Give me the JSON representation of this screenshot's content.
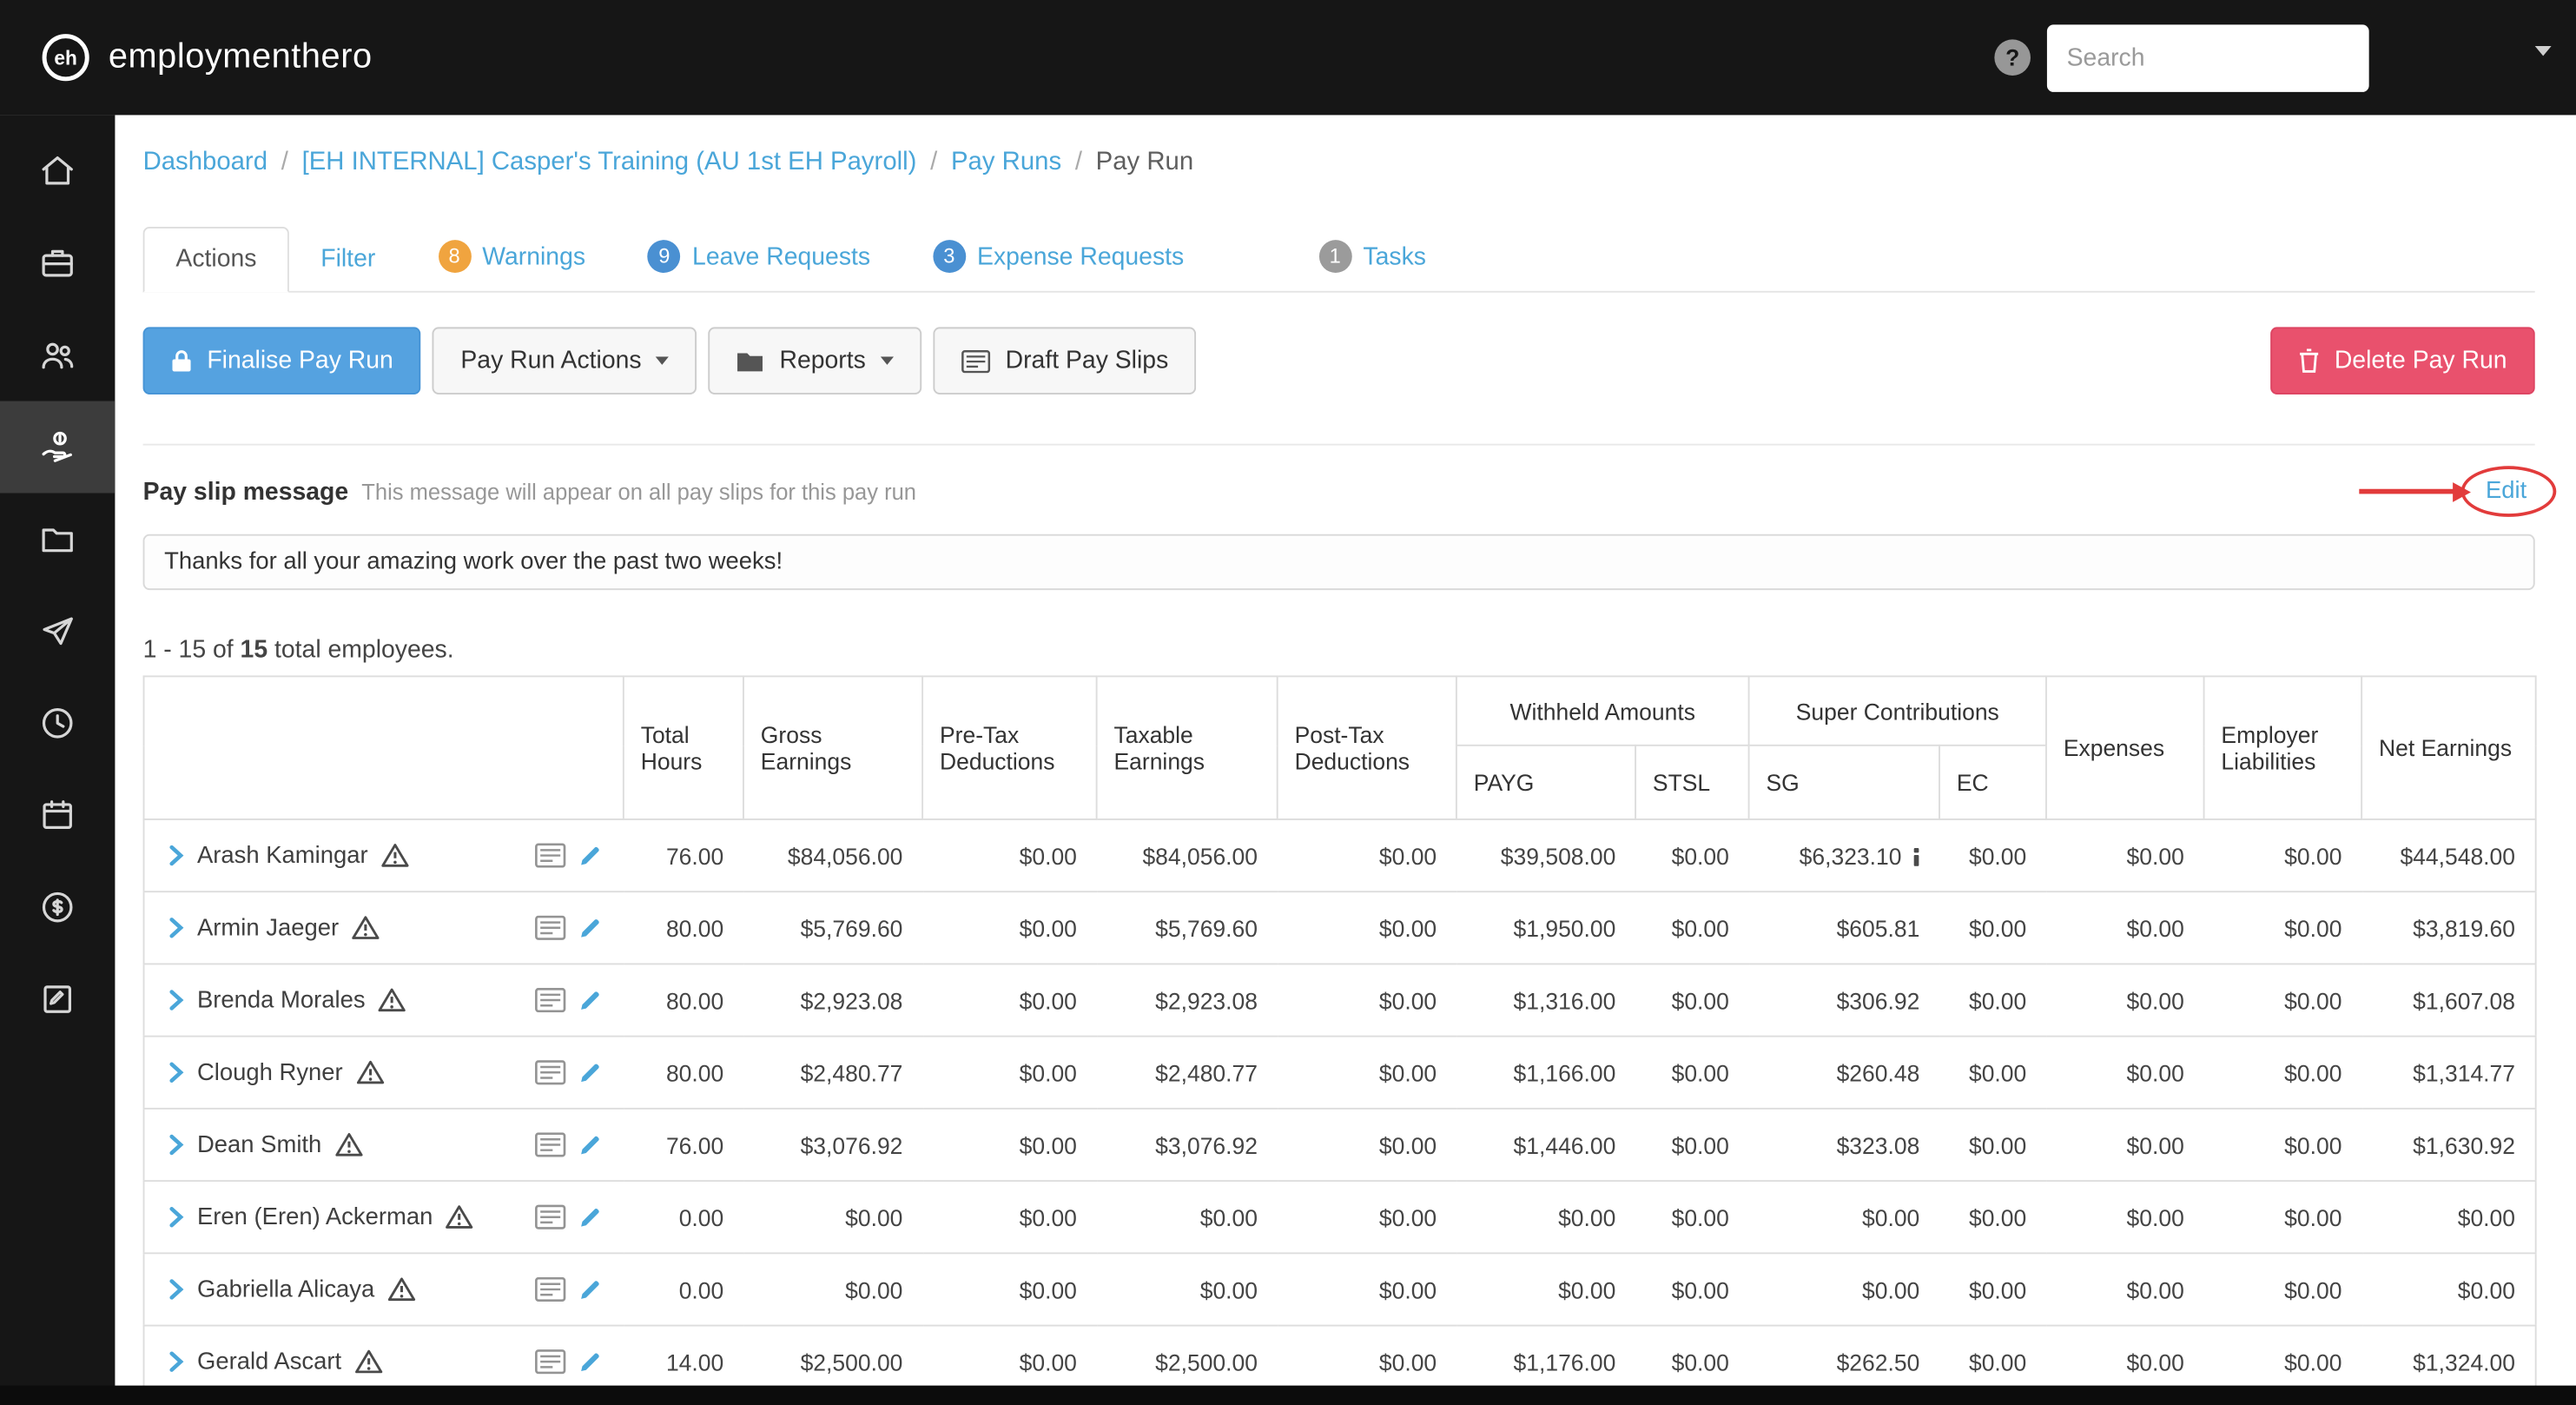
{
  "topbar": {
    "brand": "employmenthero",
    "help_label": "?",
    "search_placeholder": "Search"
  },
  "sidebar": {
    "items": [
      {
        "icon": "home-icon"
      },
      {
        "icon": "briefcase-icon"
      },
      {
        "icon": "people-icon"
      },
      {
        "icon": "hand-coin-icon",
        "active": true
      },
      {
        "icon": "folder-icon"
      },
      {
        "icon": "paper-plane-icon"
      },
      {
        "icon": "clock-icon"
      },
      {
        "icon": "calendar-icon"
      },
      {
        "icon": "dollar-coin-icon"
      },
      {
        "icon": "clipboard-icon"
      }
    ]
  },
  "breadcrumb": {
    "items": [
      "Dashboard",
      "[EH INTERNAL] Casper's Training (AU 1st EH Payroll)",
      "Pay Runs"
    ],
    "current": "Pay Run",
    "separator": "/"
  },
  "tabs": [
    {
      "label": "Actions",
      "active": true
    },
    {
      "label": "Filter"
    },
    {
      "label": "Warnings",
      "badge": "8",
      "badge_color": "#f0a43f"
    },
    {
      "label": "Leave Requests",
      "badge": "9",
      "badge_color": "#4a90d2"
    },
    {
      "label": "Expense Requests",
      "badge": "3",
      "badge_color": "#4a90d2"
    },
    {
      "label": "Tasks",
      "badge": "1",
      "badge_color": "#9b9b9b"
    }
  ],
  "actions": {
    "finalise": "Finalise Pay Run",
    "pay_run_actions": "Pay Run Actions",
    "reports": "Reports",
    "draft_pay_slips": "Draft Pay Slips",
    "delete": "Delete Pay Run"
  },
  "pay_slip_message": {
    "title": "Pay slip message",
    "subtitle": "This message will appear on all pay slips for this pay run",
    "edit_label": "Edit",
    "message": "Thanks for all your amazing work over the past two weeks!"
  },
  "summary": {
    "prefix": "1 - 15 of ",
    "count": "15",
    "suffix": " total employees."
  },
  "table": {
    "group_headers": [
      "Withheld Amounts",
      "Super Contributions"
    ],
    "columns": [
      "Total Hours",
      "Gross Earnings",
      "Pre-Tax Deductions",
      "Taxable Earnings",
      "Post-Tax Deductions",
      "PAYG",
      "STSL",
      "SG",
      "EC",
      "Expenses",
      "Employer Liabilities",
      "Net Earnings"
    ],
    "column_keys": [
      "total-hours",
      "gross-earnings",
      "pre-tax-deductions",
      "taxable-earnings",
      "post-tax-deductions",
      "payg",
      "stsl",
      "sg",
      "ec",
      "expenses",
      "employer-liabilities",
      "net-earnings"
    ],
    "rows": [
      {
        "name": "Arash Kamingar",
        "sg_info": true,
        "values": [
          "76.00",
          "$84,056.00",
          "$0.00",
          "$84,056.00",
          "$0.00",
          "$39,508.00",
          "$0.00",
          "$6,323.10",
          "$0.00",
          "$0.00",
          "$0.00",
          "$44,548.00"
        ]
      },
      {
        "name": "Armin Jaeger",
        "values": [
          "80.00",
          "$5,769.60",
          "$0.00",
          "$5,769.60",
          "$0.00",
          "$1,950.00",
          "$0.00",
          "$605.81",
          "$0.00",
          "$0.00",
          "$0.00",
          "$3,819.60"
        ]
      },
      {
        "name": "Brenda Morales",
        "values": [
          "80.00",
          "$2,923.08",
          "$0.00",
          "$2,923.08",
          "$0.00",
          "$1,316.00",
          "$0.00",
          "$306.92",
          "$0.00",
          "$0.00",
          "$0.00",
          "$1,607.08"
        ]
      },
      {
        "name": "Clough Ryner",
        "values": [
          "80.00",
          "$2,480.77",
          "$0.00",
          "$2,480.77",
          "$0.00",
          "$1,166.00",
          "$0.00",
          "$260.48",
          "$0.00",
          "$0.00",
          "$0.00",
          "$1,314.77"
        ]
      },
      {
        "name": "Dean Smith",
        "values": [
          "76.00",
          "$3,076.92",
          "$0.00",
          "$3,076.92",
          "$0.00",
          "$1,446.00",
          "$0.00",
          "$323.08",
          "$0.00",
          "$0.00",
          "$0.00",
          "$1,630.92"
        ]
      },
      {
        "name": "Eren (Eren) Ackerman",
        "values": [
          "0.00",
          "$0.00",
          "$0.00",
          "$0.00",
          "$0.00",
          "$0.00",
          "$0.00",
          "$0.00",
          "$0.00",
          "$0.00",
          "$0.00",
          "$0.00"
        ]
      },
      {
        "name": "Gabriella Alicaya",
        "values": [
          "0.00",
          "$0.00",
          "$0.00",
          "$0.00",
          "$0.00",
          "$0.00",
          "$0.00",
          "$0.00",
          "$0.00",
          "$0.00",
          "$0.00",
          "$0.00"
        ]
      },
      {
        "name": "Gerald Ascart",
        "values": [
          "14.00",
          "$2,500.00",
          "$0.00",
          "$2,500.00",
          "$0.00",
          "$1,176.00",
          "$0.00",
          "$262.50",
          "$0.00",
          "$0.00",
          "$0.00",
          "$1,324.00"
        ]
      }
    ],
    "row_icon_names": [
      "chevron-right-icon",
      "warning-triangle-icon",
      "payslip-icon",
      "edit-pencil-icon",
      "info-icon"
    ]
  },
  "colors": {
    "link_blue": "#4aa6d9",
    "primary_button": "#55a2e0",
    "danger_button": "#e9516d",
    "warning_badge": "#f0a43f",
    "blue_badge": "#4a90d2",
    "gray_badge": "#9b9b9b",
    "annotation_red": "#e23b3b",
    "topbar_bg": "#161616"
  }
}
